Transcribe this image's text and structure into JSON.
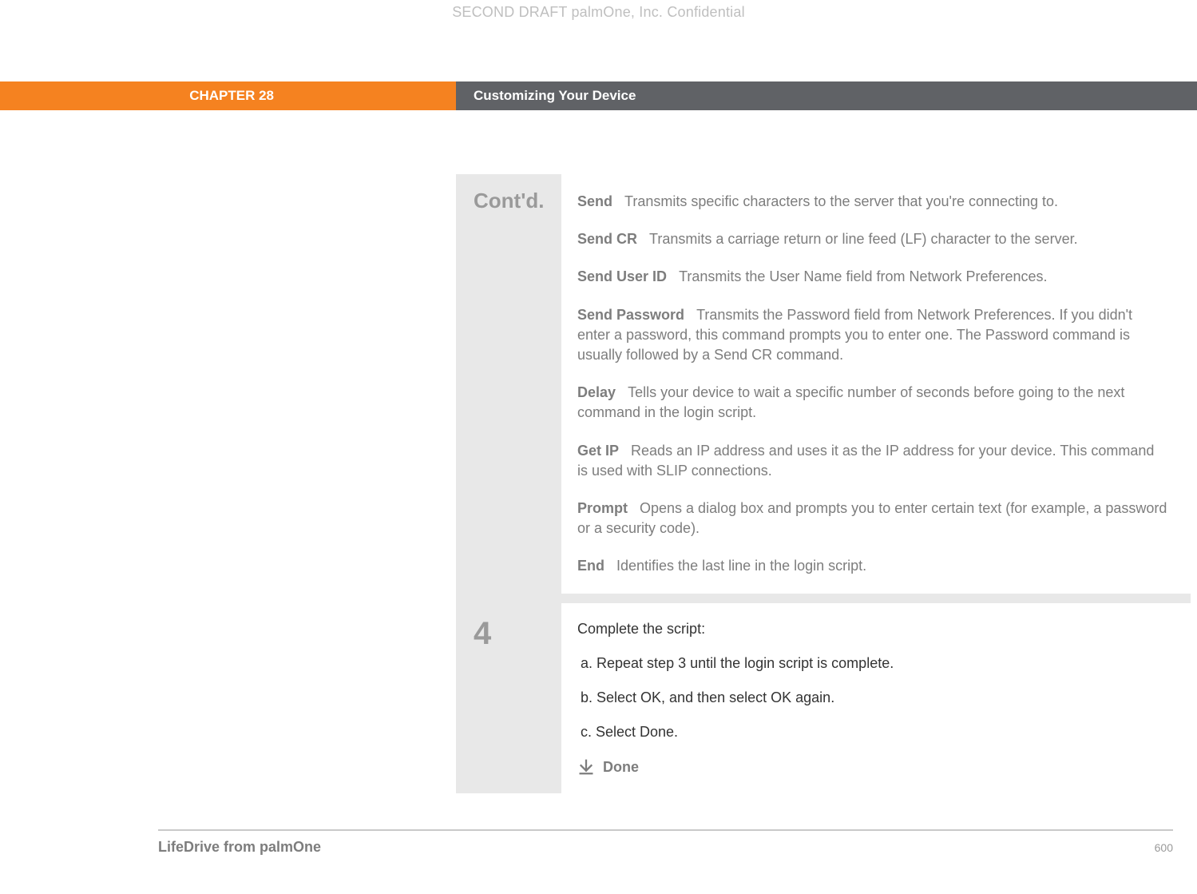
{
  "watermark": "SECOND DRAFT palmOne, Inc.  Confidential",
  "chapter": {
    "number": "CHAPTER 28",
    "title": "Customizing Your Device"
  },
  "contd": {
    "label": "Cont'd.",
    "items": [
      {
        "term": "Send",
        "desc": "Transmits specific characters to the server that you're connecting to."
      },
      {
        "term": "Send CR",
        "desc": "Transmits a carriage return or line feed (LF) character to the server."
      },
      {
        "term": "Send User ID",
        "desc": "Transmits the User Name field from Network Preferences."
      },
      {
        "term": "Send Password",
        "desc": "Transmits the Password field from Network Preferences. If you didn't enter a password, this command prompts you to enter one. The Password command is usually followed by a Send CR command."
      },
      {
        "term": "Delay",
        "desc": "Tells your device to wait a specific number of seconds before going to the next command in the login script."
      },
      {
        "term": "Get IP",
        "desc": "Reads an IP address and uses it as the IP address for your device. This command is used with SLIP connections."
      },
      {
        "term": "Prompt",
        "desc": "Opens a dialog box and prompts you to enter certain text (for example, a password or a security code)."
      },
      {
        "term": "End",
        "desc": "Identifies the last line in the login script."
      }
    ]
  },
  "step4": {
    "number": "4",
    "lead": "Complete the script:",
    "a": "a.  Repeat step 3 until the login script is complete.",
    "b": "b.  Select OK, and then select OK again.",
    "c": "c.  Select Done.",
    "done": "Done"
  },
  "footer": {
    "title": "LifeDrive from palmOne",
    "page": "600"
  }
}
